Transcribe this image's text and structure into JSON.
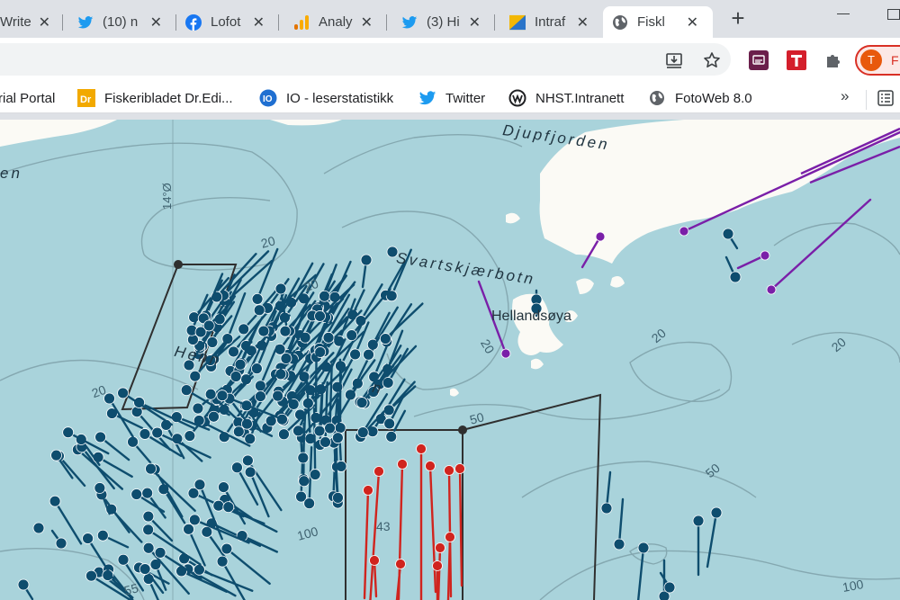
{
  "tabs": [
    {
      "label": "Write",
      "icon": "write-icon"
    },
    {
      "label": "(10) n",
      "icon": "twitter-bird-icon"
    },
    {
      "label": "Lofot",
      "icon": "facebook-icon"
    },
    {
      "label": "Analy",
      "icon": "analytics-bars-icon"
    },
    {
      "label": "(3) Hi",
      "icon": "twitter-bird-icon"
    },
    {
      "label": "Intraf",
      "icon": "intrafish-icon"
    },
    {
      "label": "Fiskl",
      "icon": "globe-icon"
    }
  ],
  "toolbar": {
    "install_icon": "install-app-icon",
    "bookmark_star_icon": "star-icon",
    "profile_letter": "T",
    "profile_name_initial": "F"
  },
  "bookmarks": [
    {
      "label": "rial Portal",
      "icon": ""
    },
    {
      "label": "Fiskeribladet Dr.Edi...",
      "icon": "dr-icon"
    },
    {
      "label": "IO - leserstatistikk",
      "icon": "io-icon"
    },
    {
      "label": "Twitter",
      "icon": "twitter-bird-icon"
    },
    {
      "label": "NHST.Intranett",
      "icon": "nhst-icon"
    },
    {
      "label": "FotoWeb 8.0",
      "icon": "globe-icon"
    }
  ],
  "bookmarks_more": "»",
  "colors": {
    "sea": "#a9d3db",
    "land": "#fbfaf5",
    "blue_vessel": "#0e4d6e",
    "red_vessel": "#d0241e",
    "purple_vessel": "#7a1fa8",
    "zone_outline": "#2f2f2f",
    "contour": "#7c9ea6"
  },
  "map": {
    "place_labels": {
      "djupfjorden": "Djupfjorden",
      "svartskjaerbotn": "Svartskjærbotn",
      "hellandsoya": "Hellandsøya",
      "henningsvaer_left": "Henn",
      "henningsvaer_right": "n",
      "left_edge": "en",
      "longitude": "14°Ø"
    },
    "depth_labels": [
      "20",
      "20",
      "20",
      "20",
      "20",
      "20",
      "50",
      "50",
      "100",
      "100",
      "43",
      "55"
    ]
  }
}
